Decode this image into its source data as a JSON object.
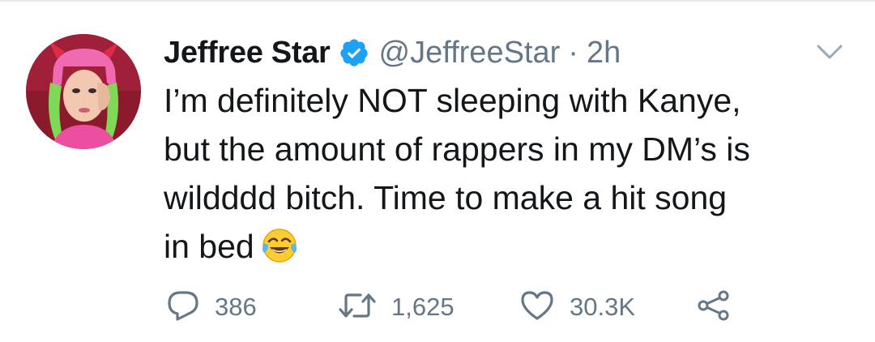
{
  "tweet": {
    "author_name": "Jeffree Star",
    "handle": "@JeffreeStar",
    "separator": "·",
    "time": "2h",
    "verified": true,
    "text": "I’m definitely NOT sleeping with Kanye,\nbut the amount of rappers in my DM’s is\nwildddd bitch. Time to make a hit song\nin bed",
    "emoji": "face-with-tears-of-joy"
  },
  "actions": {
    "reply_count": "386",
    "retweet_count": "1,625",
    "like_count": "30.3K"
  },
  "colors": {
    "text": "#14171a",
    "secondary": "#657786",
    "verified": "#1da1f2",
    "divider": "#e6ecf0"
  },
  "icons": {
    "verified": "verified-badge-icon",
    "caret": "chevron-down-icon",
    "reply": "reply-icon",
    "retweet": "retweet-icon",
    "like": "heart-icon",
    "share": "share-icon"
  }
}
